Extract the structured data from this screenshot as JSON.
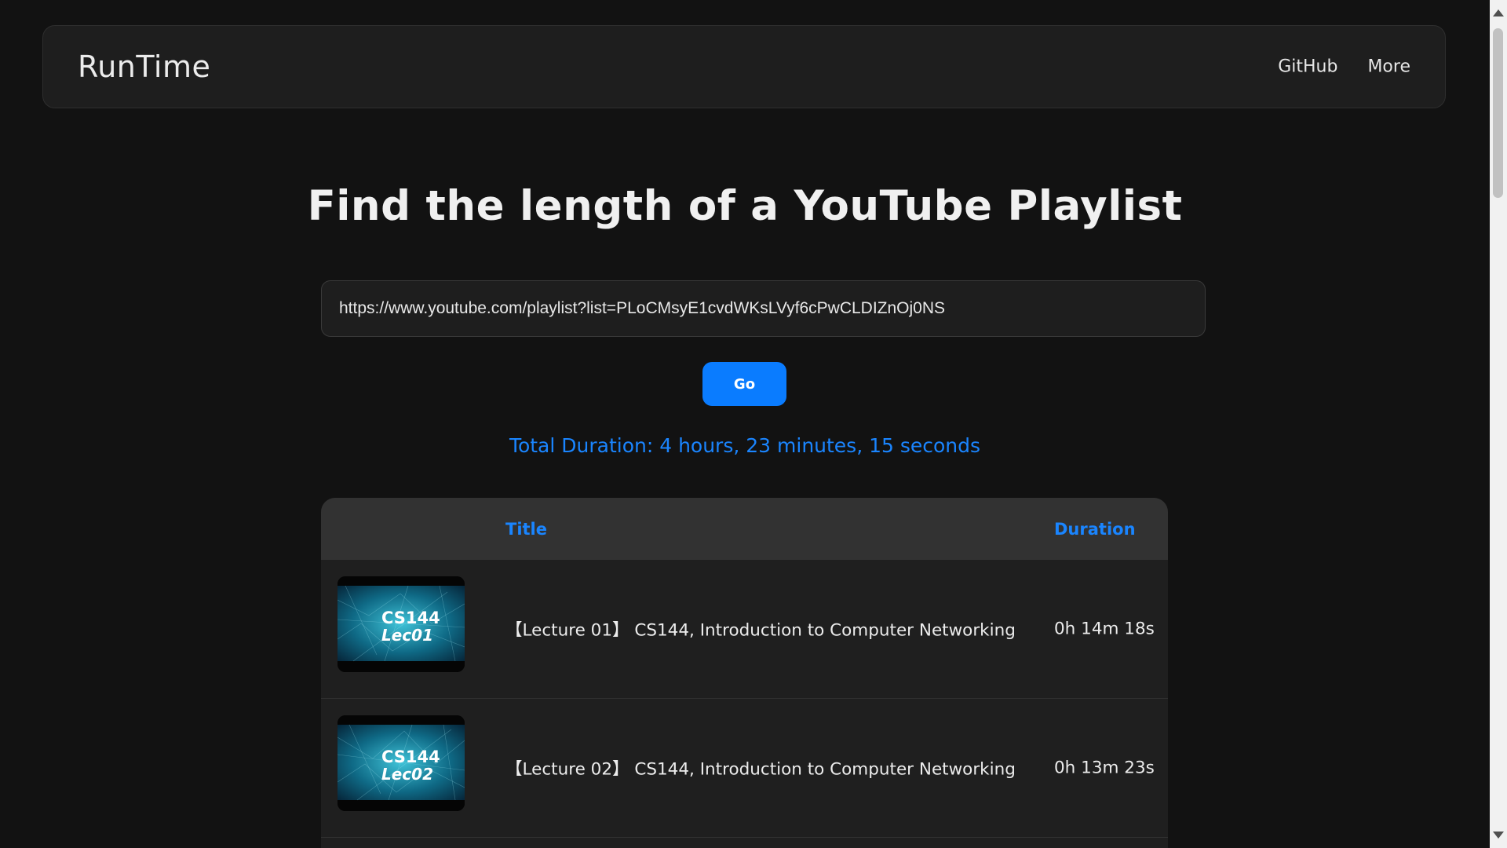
{
  "navbar": {
    "brand": "RunTime",
    "links": [
      "GitHub",
      "More"
    ]
  },
  "hero": {
    "title": "Find the length of a YouTube Playlist"
  },
  "search": {
    "value": "https://www.youtube.com/playlist?list=PLoCMsyE1cvdWKsLVyf6cPwCLDIZnOj0NS",
    "go_label": "Go"
  },
  "total_duration": "Total Duration: 4 hours, 23 minutes, 15 seconds",
  "table": {
    "headers": {
      "title": "Title",
      "duration": "Duration"
    },
    "rows": [
      {
        "title": "【Lecture 01】 CS144, Introduction to Computer Networking",
        "duration": "0h 14m 18s",
        "thumb": {
          "line1": "CS144",
          "line2": "Lec01"
        }
      },
      {
        "title": "【Lecture 02】 CS144, Introduction to Computer Networking",
        "duration": "0h 13m 23s",
        "thumb": {
          "line1": "CS144",
          "line2": "Lec02"
        }
      }
    ]
  },
  "colors": {
    "accent": "#1a85ff",
    "button": "#0a7cff",
    "background": "#121212"
  }
}
